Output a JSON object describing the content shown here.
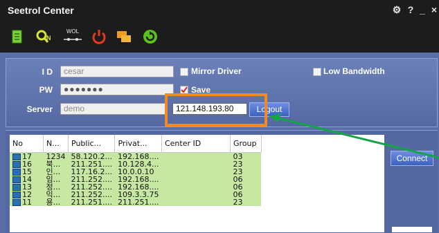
{
  "window": {
    "title": "Seetrol Center",
    "controls": [
      "⚙",
      "?",
      "_",
      "×"
    ]
  },
  "toolbar": {
    "wol_label": "WOL",
    "icons": [
      "document-icon",
      "search-user-icon",
      "wol-icon",
      "power-icon",
      "chat-icon",
      "refresh-icon"
    ]
  },
  "login": {
    "id_label": "I D",
    "id_value": "cesar",
    "pw_label": "PW",
    "pw_value": "●●●●●●●",
    "server_label": "Server",
    "server_value": "demo",
    "mirror_driver_label": "Mirror Driver",
    "save_label": "Save",
    "low_bandwidth_label": "Low Bandwidth",
    "ip_value": "121.148.193.80",
    "logout_label": "Logout"
  },
  "list": {
    "columns": [
      "No",
      "N...",
      "Public...",
      "Privat...",
      "Center ID",
      "Group"
    ],
    "rows": [
      [
        "17",
        "1234",
        "58.120.2...",
        "192.168....",
        "",
        "03"
      ],
      [
        "16",
        "북...",
        "211.251....",
        "10.128.4...",
        "",
        "23"
      ],
      [
        "15",
        "인...",
        "117.16.2...",
        "10.0.0.10",
        "",
        "23"
      ],
      [
        "14",
        "임...",
        "211.252....",
        "192.168....",
        "",
        "06"
      ],
      [
        "13",
        "정...",
        "211.252....",
        "192.168....",
        "",
        "06"
      ],
      [
        "12",
        "익...",
        "211.252....",
        "109.3.3.75",
        "",
        "06"
      ],
      [
        "11",
        "용...",
        "211.251....",
        "211.251....",
        "",
        "23"
      ]
    ]
  },
  "connect_label": "Connect",
  "colors": {
    "highlight_box": "#f08a24",
    "arrow": "#16a34a",
    "row_bg": "#c6e8a3"
  }
}
